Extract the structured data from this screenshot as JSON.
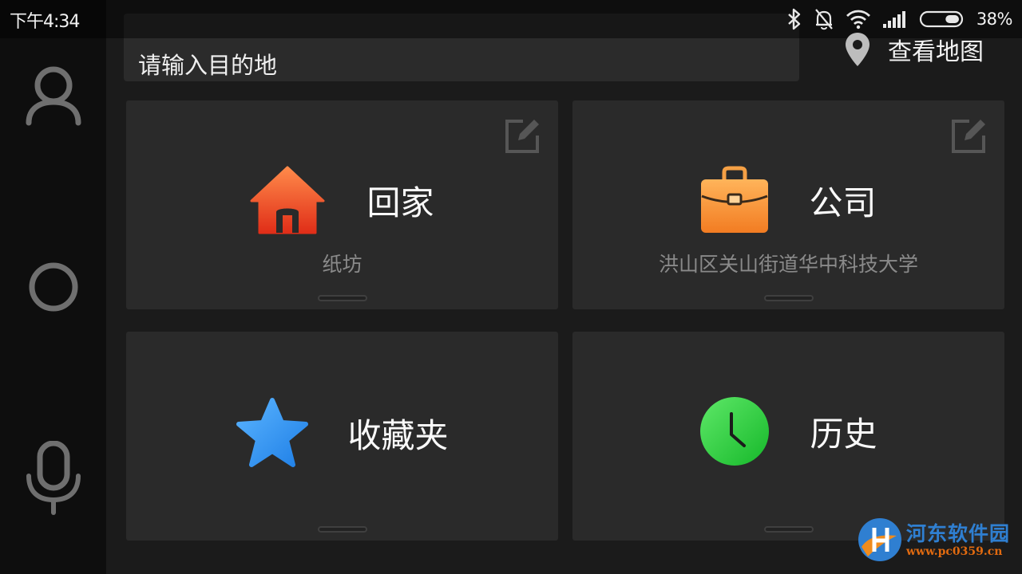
{
  "status_bar": {
    "time": "下午4:34",
    "battery_percent": "38%",
    "battery_level": 0.38,
    "icons": [
      "bluetooth-icon",
      "mute-bell-icon",
      "wifi-icon",
      "signal-icon",
      "battery-icon"
    ]
  },
  "search": {
    "placeholder": "请输入目的地"
  },
  "map_button": {
    "label": "查看地图",
    "icon": "map-pin-icon"
  },
  "sidebar": {
    "items": [
      {
        "icon": "user-icon"
      },
      {
        "icon": "circle-icon"
      },
      {
        "icon": "microphone-icon"
      }
    ]
  },
  "cards": [
    {
      "title": "回家",
      "subtitle": "纸坊",
      "icon": "home-icon",
      "color": "#e8482a",
      "editable": true
    },
    {
      "title": "公司",
      "subtitle": "洪山区关山街道华中科技大学",
      "icon": "briefcase-icon",
      "color": "#f28a2a",
      "editable": true
    },
    {
      "title": "收藏夹",
      "icon": "star-icon",
      "color": "#2f90ee"
    },
    {
      "title": "历史",
      "icon": "clock-icon",
      "color": "#2ccf3e"
    }
  ],
  "watermark": {
    "name": "河东软件园",
    "url": "www.pc0359.cn"
  },
  "colors": {
    "background": "#1b1b1b",
    "rail": "#0e0e0e",
    "card": "#2a2a2a",
    "icon_gray": "#6f6f6f",
    "subtitle_gray": "#8a8a8a"
  }
}
